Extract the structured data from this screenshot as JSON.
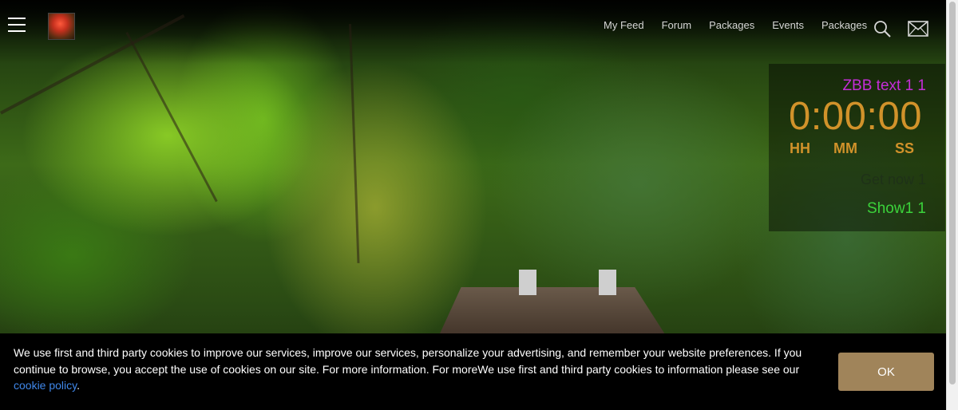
{
  "header": {
    "nav": [
      {
        "label": "My Feed"
      },
      {
        "label": "Forum"
      },
      {
        "label": "Packages"
      },
      {
        "label": "Events"
      },
      {
        "label": "Packages"
      }
    ],
    "icons": {
      "menu": "hamburger-icon",
      "search": "search-icon",
      "mail": "mail-icon"
    }
  },
  "widget": {
    "title": "ZBB text 1 1",
    "timer": "0:00:00",
    "labels": {
      "hours": "HH",
      "minutes": "MM",
      "seconds": "SS"
    },
    "ghost_text": "Get now 1",
    "show_text": "Show1 1",
    "colors": {
      "title": "#c52dd8",
      "timer": "#d1922a",
      "show": "#3bd33b"
    }
  },
  "cookie": {
    "message_1": "We use first and third party cookies to improve our services, improve our services, personalize your advertising, and remember your website preferences. If you continue to browse, you accept the use of cookies on our site. For more information. For moreWe use first and third party cookies to information please see our ",
    "link": "cookie policy",
    "message_end": ".",
    "ok_label": "OK",
    "button_color": "#a0845a"
  }
}
